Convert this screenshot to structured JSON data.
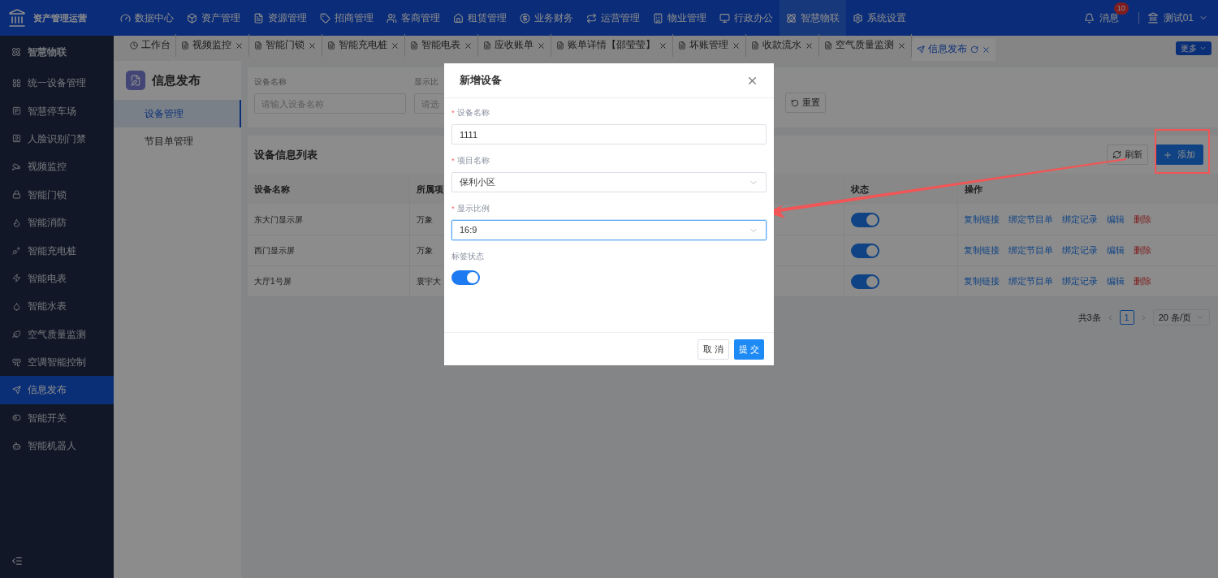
{
  "app": {
    "title": "资产管理运营"
  },
  "top_nav": [
    {
      "label": "数据中心",
      "selected": false
    },
    {
      "label": "资产管理",
      "selected": false
    },
    {
      "label": "资源管理",
      "selected": false
    },
    {
      "label": "招商管理",
      "selected": false
    },
    {
      "label": "客商管理",
      "selected": false
    },
    {
      "label": "租赁管理",
      "selected": false
    },
    {
      "label": "业务财务",
      "selected": false
    },
    {
      "label": "运营管理",
      "selected": false
    },
    {
      "label": "物业管理",
      "selected": false
    },
    {
      "label": "行政办公",
      "selected": false
    },
    {
      "label": "智慧物联",
      "selected": true
    },
    {
      "label": "系统设置",
      "selected": false
    }
  ],
  "header_right": {
    "messages": {
      "label": "消息",
      "badge": "10"
    },
    "user": "测试01"
  },
  "sidebar": {
    "title": "智慧物联",
    "items": [
      {
        "label": "统一设备管理",
        "selected": false
      },
      {
        "label": "智慧停车场",
        "selected": false
      },
      {
        "label": "人脸识别门禁",
        "selected": false
      },
      {
        "label": "视频监控",
        "selected": false
      },
      {
        "label": "智能门锁",
        "selected": false
      },
      {
        "label": "智能消防",
        "selected": false
      },
      {
        "label": "智能充电桩",
        "selected": false
      },
      {
        "label": "智能电表",
        "selected": false
      },
      {
        "label": "智能水表",
        "selected": false
      },
      {
        "label": "空气质量监测",
        "selected": false
      },
      {
        "label": "空调智能控制",
        "selected": false
      },
      {
        "label": "信息发布",
        "selected": true
      },
      {
        "label": "智能开关",
        "selected": false
      },
      {
        "label": "智能机器人",
        "selected": false
      }
    ]
  },
  "tabs": [
    {
      "label": "工作台",
      "selected": false,
      "closable": false
    },
    {
      "label": "视频监控",
      "selected": false,
      "closable": true
    },
    {
      "label": "智能门锁",
      "selected": false,
      "closable": true
    },
    {
      "label": "智能充电桩",
      "selected": false,
      "closable": true
    },
    {
      "label": "智能电表",
      "selected": false,
      "closable": true
    },
    {
      "label": "应收账单",
      "selected": false,
      "closable": true
    },
    {
      "label": "账单详情【邵莹莹】",
      "selected": false,
      "closable": true
    },
    {
      "label": "坏账管理",
      "selected": false,
      "closable": true
    },
    {
      "label": "收款流水",
      "selected": false,
      "closable": true
    },
    {
      "label": "空气质量监测",
      "selected": false,
      "closable": true
    },
    {
      "label": "信息发布",
      "selected": true,
      "closable": true
    }
  ],
  "more_button": "更多",
  "sub_sidebar": {
    "title": "信息发布",
    "items": [
      {
        "label": "设备管理",
        "selected": true
      },
      {
        "label": "节目单管理",
        "selected": false
      }
    ]
  },
  "search": {
    "fields": [
      {
        "label": "设备名称",
        "placeholder": "请输入设备名称"
      },
      {
        "label": "显示比",
        "placeholder": "请选"
      }
    ],
    "reset_button": "重置"
  },
  "table": {
    "title": "设备信息列表",
    "refresh_button": "刷新",
    "add_button": "添加",
    "columns": [
      "设备名称",
      "所属项",
      "状态",
      "操作"
    ],
    "rows": [
      {
        "name": "东大门显示屏",
        "project": "万象",
        "on": true,
        "actions": [
          {
            "label": "复制链接",
            "kind": "link"
          },
          {
            "label": "绑定节目单",
            "kind": "link"
          },
          {
            "label": "绑定记录",
            "kind": "link"
          },
          {
            "label": "编辑",
            "kind": "link"
          },
          {
            "label": "删除",
            "kind": "danger"
          }
        ]
      },
      {
        "name": "西门显示屏",
        "project": "万象",
        "on": true,
        "actions": [
          {
            "label": "复制链接",
            "kind": "link"
          },
          {
            "label": "绑定节目单",
            "kind": "link"
          },
          {
            "label": "绑定记录",
            "kind": "link"
          },
          {
            "label": "编辑",
            "kind": "link"
          },
          {
            "label": "删除",
            "kind": "danger"
          }
        ]
      },
      {
        "name": "大厅1号屏",
        "project": "寰宇大",
        "on": true,
        "actions": [
          {
            "label": "复制链接",
            "kind": "link"
          },
          {
            "label": "绑定节目单",
            "kind": "link"
          },
          {
            "label": "绑定记录",
            "kind": "link"
          },
          {
            "label": "编辑",
            "kind": "link"
          },
          {
            "label": "删除",
            "kind": "danger"
          }
        ]
      }
    ]
  },
  "pagination": {
    "total": "共3条",
    "pages": [
      {
        "label": "1",
        "selected": true
      }
    ],
    "page_size": "20 条/页"
  },
  "dialog": {
    "title": "新增设备",
    "fields": [
      {
        "kind": "input",
        "label": "设备名称",
        "required_mark": "*",
        "value": "1111"
      },
      {
        "kind": "select",
        "label": "项目名称",
        "required_mark": "*",
        "value": "保利小区",
        "focused": false
      },
      {
        "kind": "select",
        "label": "显示比例",
        "required_mark": "*",
        "value": "16:9",
        "focused": true
      },
      {
        "kind": "switch",
        "label": "标签状态",
        "on": true
      }
    ],
    "buttons": [
      {
        "label": "取 消",
        "kind": "default"
      },
      {
        "label": "提 交",
        "kind": "primary"
      }
    ]
  }
}
